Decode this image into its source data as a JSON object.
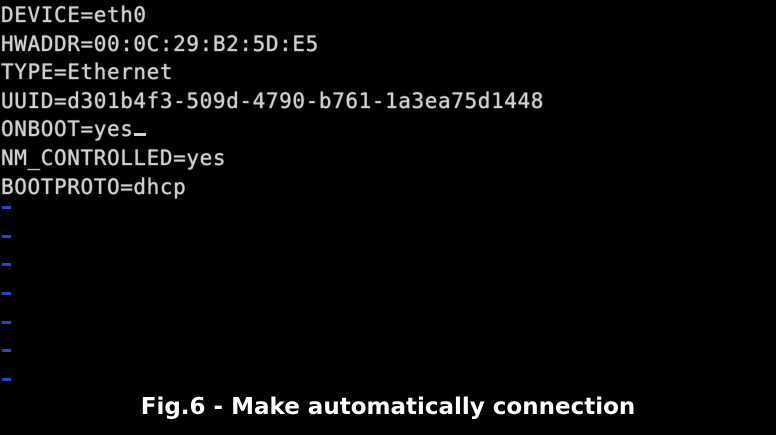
{
  "terminal": {
    "lines": [
      "DEVICE=eth0",
      "HWADDR=00:0C:29:B2:5D:E5",
      "TYPE=Ethernet",
      "UUID=d301b4f3-509d-4790-b761-1a3ea75d1448",
      "ONBOOT=yes",
      "NM_CONTROLLED=yes",
      "BOOTPROTO=dhcp"
    ],
    "empty_line_marker": "~",
    "empty_line_count": 7
  },
  "caption": "Fig.6 - Make automatically connection",
  "colors": {
    "background": "#000000",
    "text": "#d0d0d0",
    "tilde": "#2646c8",
    "caption": "#ffffff"
  }
}
